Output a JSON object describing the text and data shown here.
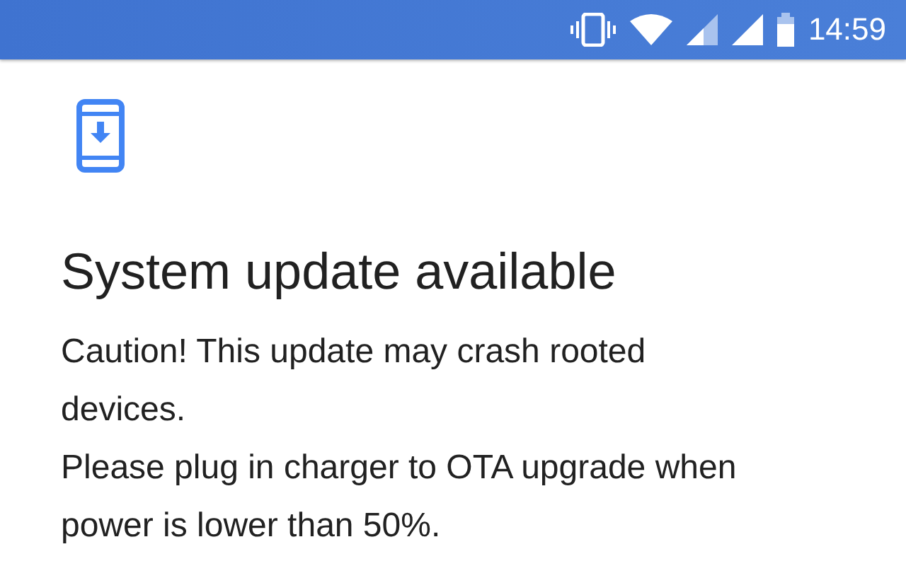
{
  "status_bar": {
    "time": "14:59"
  },
  "title": "System update available",
  "messages": [
    "Caution! This update may crash rooted devices.",
    "Please plug in charger to OTA upgrade when power is lower than 50%."
  ]
}
